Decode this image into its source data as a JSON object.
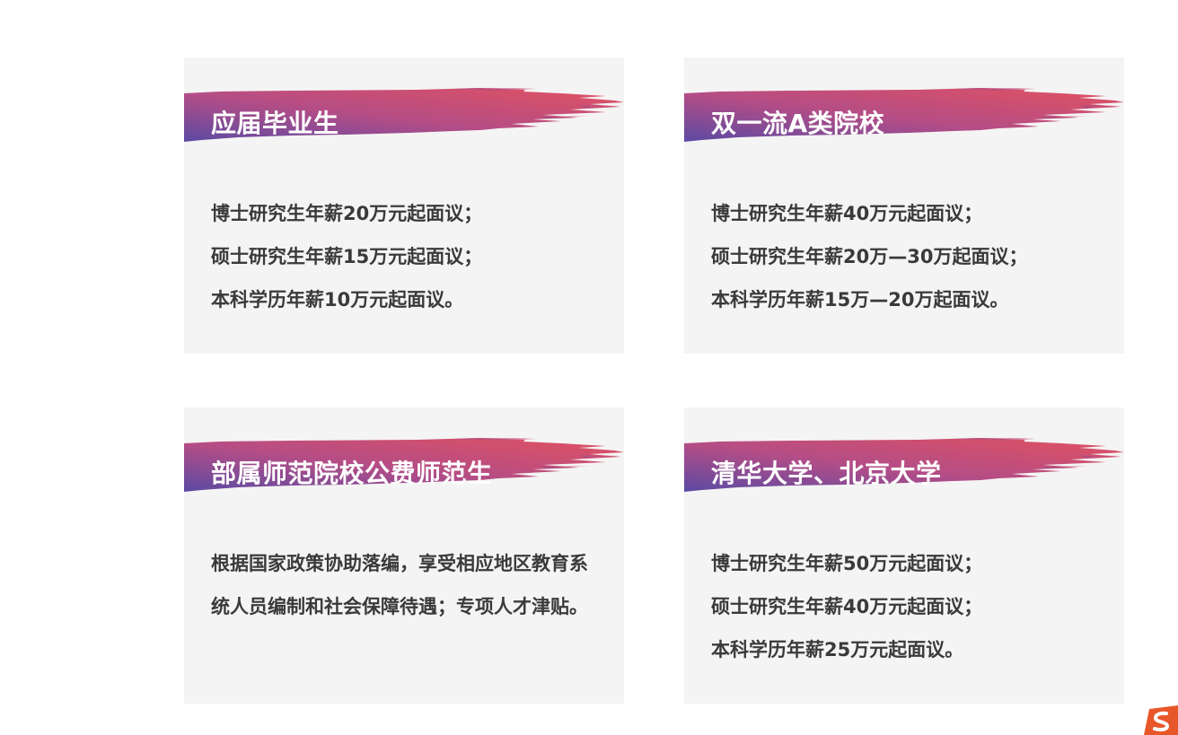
{
  "cards": [
    {
      "title": "应届毕业生",
      "lines": [
        "博士研究生年薪20万元起面议；",
        "硕士研究生年薪15万元起面议；",
        "本科学历年薪10万元起面议。"
      ]
    },
    {
      "title": "双一流A类院校",
      "lines": [
        "博士研究生年薪40万元起面议；",
        "硕士研究生年薪20万—30万起面议；",
        "本科学历年薪15万—20万起面议。"
      ]
    },
    {
      "title": "部属师范院校公费师范生",
      "paragraph": "根据国家政策协助落编，享受相应地区教育系统人员编制和社会保障待遇；专项人才津贴。"
    },
    {
      "title": "清华大学、北京大学",
      "lines": [
        "博士研究生年薪50万元起面议；",
        "硕士研究生年薪40万元起面议；",
        "本科学历年薪25万元起面议。"
      ]
    }
  ],
  "colors": {
    "card_background": "#f4f4f4",
    "banner_gradient_start": "#5b4aa3",
    "banner_gradient_mid": "#b44d86",
    "banner_gradient_end": "#e2515f",
    "body_text": "#3a3a3a"
  },
  "corner_logo": {
    "icon": "sogou-ime-icon",
    "color": "#e8572a"
  }
}
